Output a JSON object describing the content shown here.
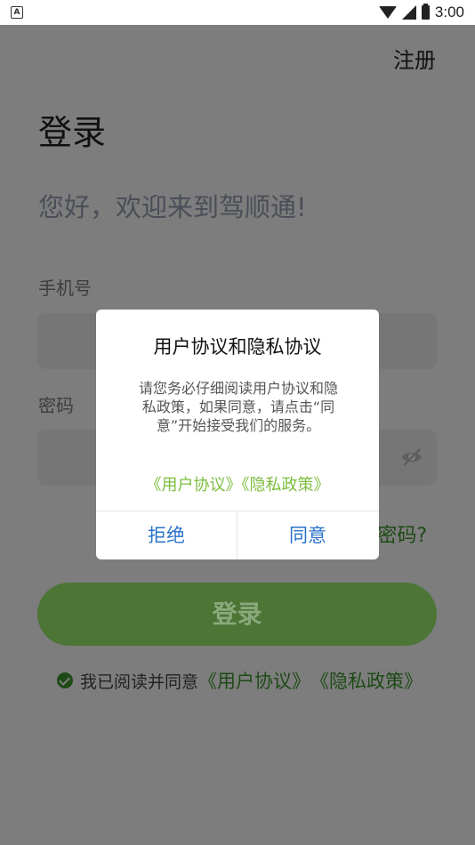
{
  "status": {
    "time": "3:00",
    "notif": "A"
  },
  "header": {
    "register_label": "注册"
  },
  "page": {
    "title": "登录",
    "welcome": "您好，欢迎来到驾顺通!",
    "phone_label": "手机号",
    "password_label": "密码",
    "forgot_partial": "密码?",
    "login_button": "登录"
  },
  "agreement": {
    "text": "我已阅读并同意",
    "user_agreement": "《用户协议》",
    "privacy_policy": "《隐私政策》"
  },
  "dialog": {
    "title": "用户协议和隐私协议",
    "body": "请您务必仔细阅读用户协议和隐私政策，如果同意，请点击“同意”开始接受我们的服务。",
    "link_user": "《用户协议》",
    "link_privacy": "《隐私政策》",
    "reject_label": "拒绝",
    "agree_label": "同意"
  },
  "colors": {
    "accent_green": "#4c7536",
    "link_green": "#7cbd3c",
    "button_blue": "#2a72c9"
  }
}
